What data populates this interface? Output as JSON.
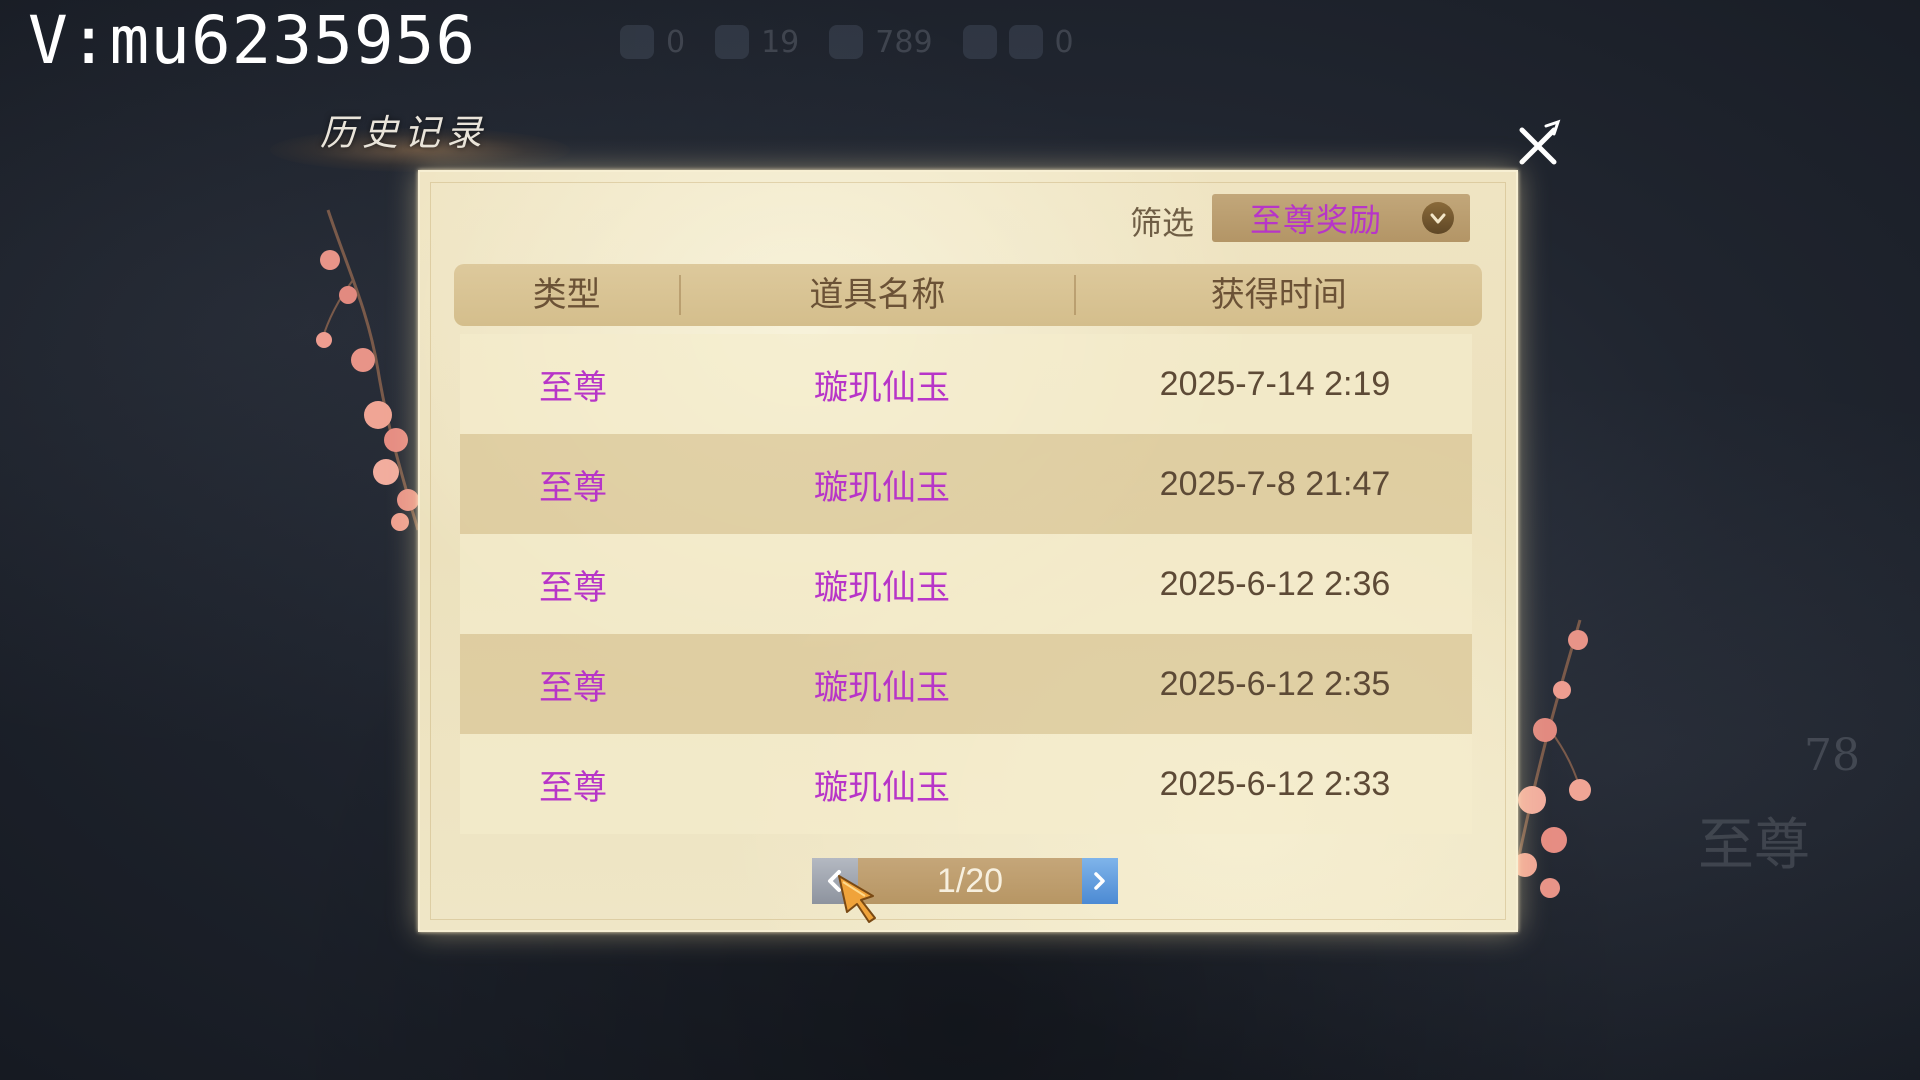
{
  "watermark": "V:mu6235956",
  "background": {
    "hud_values": [
      "0",
      "19",
      "789",
      "0"
    ],
    "side_label": "78",
    "side_big": "至尊"
  },
  "panel": {
    "title": "历史记录",
    "filter_label": "筛选",
    "filter_value": "至尊奖励",
    "columns": [
      "类型",
      "道具名称",
      "获得时间"
    ],
    "rows": [
      {
        "type": "至尊",
        "item": "璇玑仙玉",
        "time": "2025-7-14 2:19"
      },
      {
        "type": "至尊",
        "item": "璇玑仙玉",
        "time": "2025-7-8 21:47"
      },
      {
        "type": "至尊",
        "item": "璇玑仙玉",
        "time": "2025-6-12 2:36"
      },
      {
        "type": "至尊",
        "item": "璇玑仙玉",
        "time": "2025-6-12 2:35"
      },
      {
        "type": "至尊",
        "item": "璇玑仙玉",
        "time": "2025-6-12 2:33"
      }
    ],
    "pagination": "1/20"
  },
  "icons": {
    "close": "close-icon",
    "dropdown": "chevron-down-icon",
    "prev": "chevron-left-icon",
    "next": "chevron-right-icon",
    "cursor": "pointer-cursor-icon"
  },
  "colors": {
    "rarity_purple": "#b735c8",
    "panel_parchment": "#ece1bd",
    "next_button_blue": "#4c8ad3"
  }
}
